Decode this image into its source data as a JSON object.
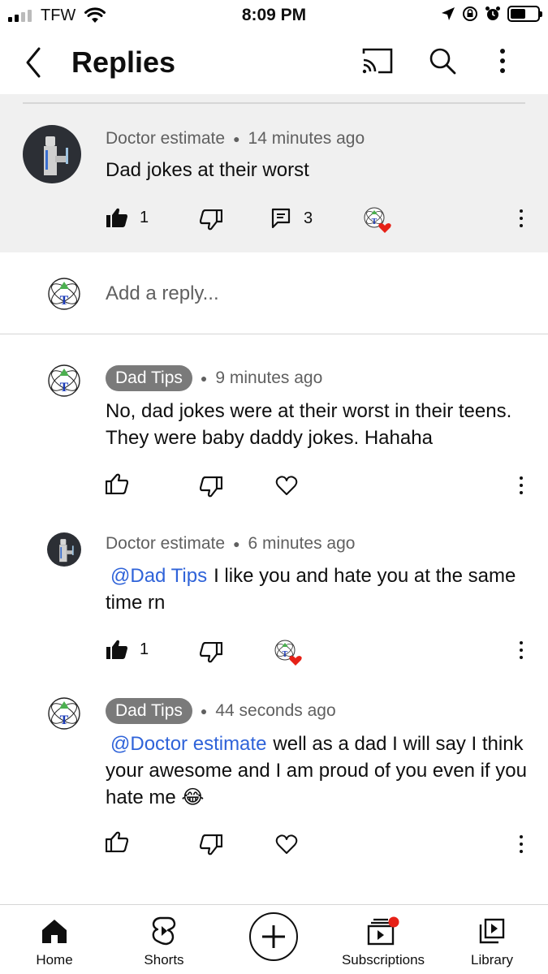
{
  "status_bar": {
    "carrier": "TFW",
    "time": "8:09 PM",
    "battery_level": 0.55,
    "icons": [
      "signal-icon",
      "wifi-icon",
      "location-icon",
      "rotation-lock-icon",
      "alarm-icon",
      "battery-icon"
    ]
  },
  "header": {
    "title": "Replies",
    "icons": [
      "back-arrow-icon",
      "cast-icon",
      "search-icon",
      "more-vertical-icon"
    ]
  },
  "original_comment": {
    "author": "Doctor estimate",
    "time": "14 minutes ago",
    "text": "Dad jokes at their worst",
    "likes": "1",
    "replies": "3",
    "liked": true,
    "creator_hearted": true
  },
  "reply_box": {
    "placeholder": "Add a reply..."
  },
  "replies": [
    {
      "author": "Dad Tips",
      "author_is_creator": true,
      "time": "9 minutes ago",
      "text": "No, dad jokes were at their worst in their teens. They were baby daddy jokes. Hahaha",
      "liked": false
    },
    {
      "author": "Doctor estimate",
      "author_is_creator": false,
      "time": "6 minutes ago",
      "mention": "@Dad Tips",
      "text": "I like you and hate you at the same time rn",
      "likes": "1",
      "liked": true,
      "creator_hearted": true
    },
    {
      "author": "Dad Tips",
      "author_is_creator": true,
      "time": "44 seconds ago",
      "mention": "@Doctor estimate",
      "text": "well as a dad I will say I think your awesome and I am proud of you even if you hate me 😂",
      "liked": false
    }
  ],
  "bottom_nav": {
    "home": "Home",
    "shorts": "Shorts",
    "subscriptions": "Subscriptions",
    "library": "Library"
  },
  "colors": {
    "highlight_bg": "#f0f0f0",
    "mention": "#2f63d9",
    "creator_chip": "#7a7a7a",
    "heart": "#e62117",
    "notification_dot": "#e62117"
  }
}
